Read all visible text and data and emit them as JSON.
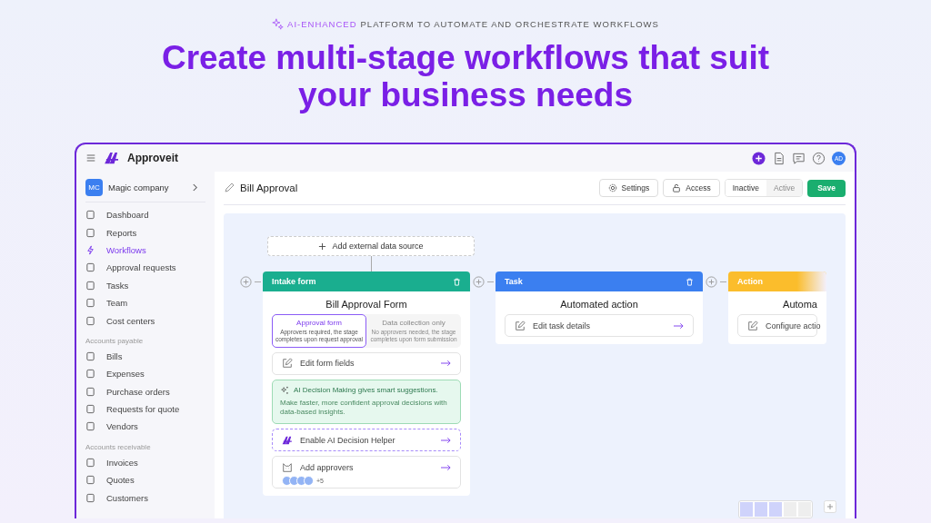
{
  "eyebrow": {
    "highlight": "AI-ENHANCED",
    "text": "PLATFORM TO AUTOMATE AND ORCHESTRATE WORKFLOWS"
  },
  "headline_lines": [
    "Create multi-stage workflows that suit",
    "your business needs"
  ],
  "app": {
    "name": "Approveit",
    "user_initials": "AD"
  },
  "company": {
    "initials": "MC",
    "name": "Magic company"
  },
  "sidebar": {
    "groups": [
      {
        "items": [
          {
            "label": "Dashboard",
            "selected": false
          },
          {
            "label": "Reports",
            "selected": false
          },
          {
            "label": "Workflows",
            "selected": true
          },
          {
            "label": "Approval requests",
            "selected": false
          },
          {
            "label": "Tasks",
            "selected": false
          },
          {
            "label": "Team",
            "selected": false
          },
          {
            "label": "Cost centers",
            "selected": false
          }
        ]
      },
      {
        "title": "Accounts payable",
        "items": [
          {
            "label": "Bills",
            "selected": false
          },
          {
            "label": "Expenses",
            "selected": false
          },
          {
            "label": "Purchase orders",
            "selected": false
          },
          {
            "label": "Requests for quote",
            "selected": false
          },
          {
            "label": "Vendors",
            "selected": false
          }
        ]
      },
      {
        "title": "Accounts receivable",
        "items": [
          {
            "label": "Invoices",
            "selected": false
          },
          {
            "label": "Quotes",
            "selected": false
          },
          {
            "label": "Customers",
            "selected": false
          }
        ]
      }
    ]
  },
  "page": {
    "title": "Bill Approval",
    "buttons": [
      {
        "kind": "settings",
        "label": "Settings"
      },
      {
        "kind": "access",
        "label": "Access"
      }
    ],
    "status_toggle": [
      {
        "label": "Inactive",
        "selected": true
      },
      {
        "label": "Active",
        "selected": false
      }
    ],
    "save": "Save"
  },
  "canvas": {
    "add_source": "Add external data source",
    "stages": [
      {
        "kind": "intake",
        "label": "Intake form",
        "color": "#1aae8f",
        "deletable": true,
        "title": "Bill Approval Form",
        "form_types": [
          {
            "title": "Approval form",
            "description": "Approvers required, the stage completes upon request approval",
            "selected": true
          },
          {
            "title": "Data collection only",
            "description": "No approvers needed, the stage completes upon form submission",
            "selected": false
          }
        ],
        "blocks": [
          {
            "kind": "link",
            "text": "Edit form fields"
          },
          {
            "kind": "ai_note",
            "title": "AI Decision Making gives smart suggestions.",
            "text": "Make faster, more confident approval decisions with data-based insights."
          },
          {
            "kind": "ai_enable",
            "text": "Enable AI Decision Helper"
          },
          {
            "kind": "approvers",
            "text": "Add approvers",
            "more": "+5"
          }
        ]
      },
      {
        "kind": "task",
        "label": "Task",
        "color": "#3b7ff0",
        "deletable": true,
        "title": "Automated action",
        "blocks": [
          {
            "kind": "link",
            "text": "Edit task details"
          }
        ]
      },
      {
        "kind": "action",
        "label": "Action",
        "color": "#fbbd2c",
        "deletable": false,
        "title": "Automa",
        "blocks": [
          {
            "kind": "link",
            "text": "Configure actio"
          }
        ]
      }
    ]
  }
}
